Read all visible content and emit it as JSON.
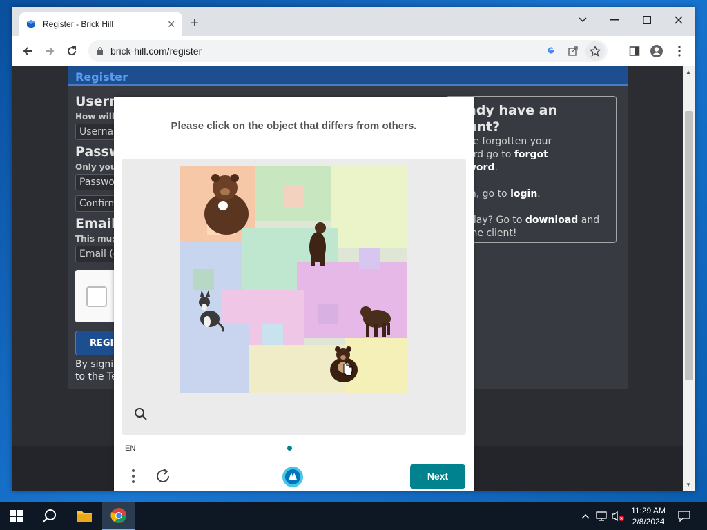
{
  "browser": {
    "tab_title": "Register - Brick Hill",
    "url": "brick-hill.com/register"
  },
  "page": {
    "header": "Register",
    "username_label": "Userna",
    "username_sub": "How will",
    "username_placeholder": "Userna",
    "password_label": "Passw",
    "password_sub": "Only you",
    "password_placeholder": "Passwo",
    "confirm_placeholder": "Confirm",
    "email_label": "Email",
    "email_sub": "This mus",
    "email_placeholder": "Email (c",
    "register_button": "REGIS",
    "terms_line1": "By signi",
    "terms_line2": "to the Te",
    "side": {
      "title_line1": "ady have an",
      "title_line2": "unt?",
      "para1_line1": "ve forgotten your",
      "para1_line2a": "ord go to ",
      "para1_line2b": "forgot",
      "para1_line3a": "word",
      "para1_line3b": ".",
      "para2a": "in, go to ",
      "para2b": "login",
      "para2c": ".",
      "para3_line1a": "play? Go to ",
      "para3_line1b": "download",
      "para3_line1c": " and",
      "para3_line2": " the client!"
    }
  },
  "captcha": {
    "prompt": "Please click on the object that differs from others.",
    "language": "EN",
    "next_button": "Next"
  },
  "taskbar": {
    "time": "11:29 AM",
    "date": "2/8/2024"
  },
  "colors": {
    "captcha_accent": "#00838f",
    "brand_header": "#1d4e8f",
    "brand_link": "#5b9cf2"
  }
}
